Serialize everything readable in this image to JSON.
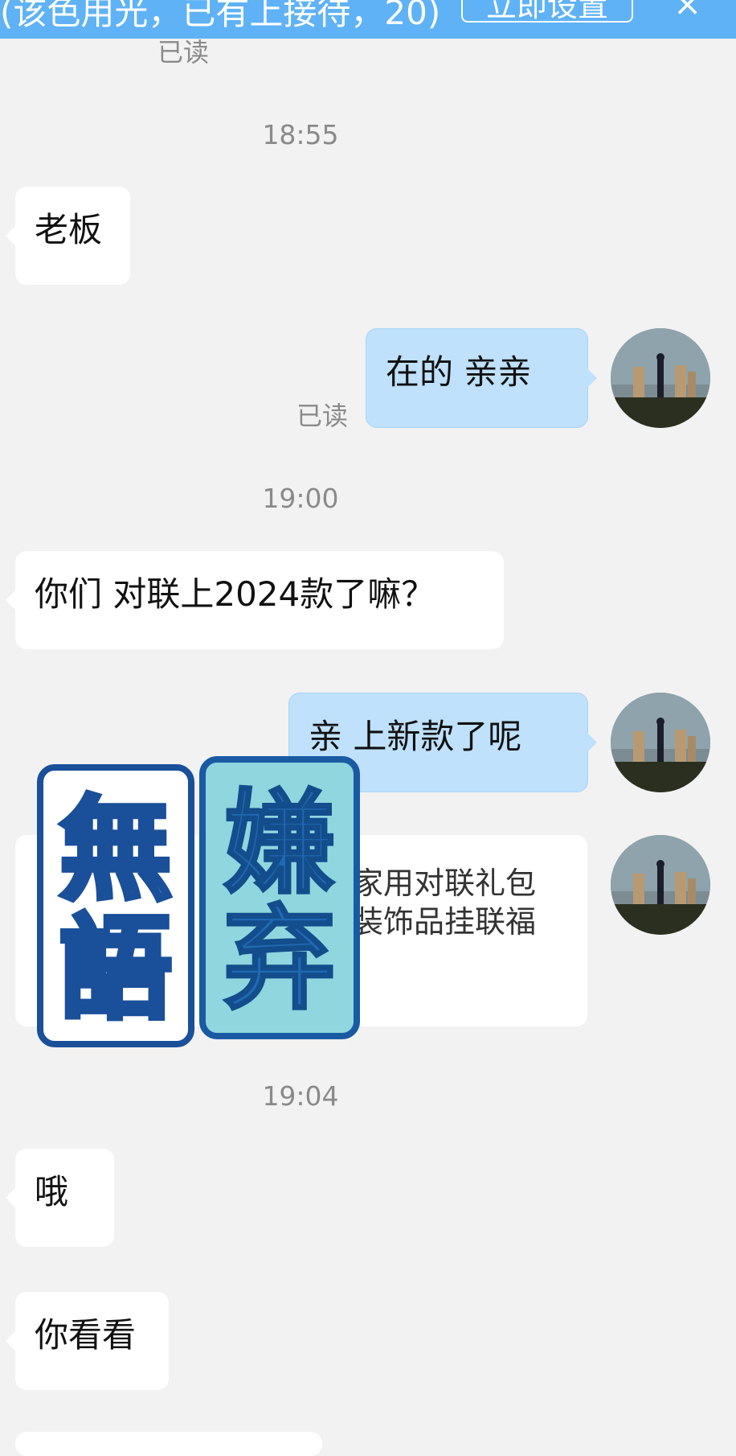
{
  "banner": {
    "text": "(该色用光，已有上接待，20)",
    "button_label": "立即设置",
    "close_label": "×"
  },
  "messages": [
    {
      "read_label": "已读"
    },
    {
      "time": "18:55"
    },
    {
      "text": "老板"
    },
    {
      "text": "在的  亲亲",
      "read_label": "已读"
    },
    {
      "time": "19:00"
    },
    {
      "text": "你们 对联上2024款了嘛？"
    },
    {
      "text": "亲  上新款了呢"
    },
    {
      "card_title": "家用对联礼包\n装饰品挂联福"
    },
    {
      "time": "19:04"
    },
    {
      "text": "哦"
    },
    {
      "text": "你看看"
    }
  ],
  "stickers": [
    "無語",
    "嫌弃"
  ],
  "colors": {
    "banner": "#5fb2f5",
    "outgoing_bubble": "#bfe1fb",
    "incoming_bubble": "#ffffff",
    "background": "#f2f2f2"
  }
}
